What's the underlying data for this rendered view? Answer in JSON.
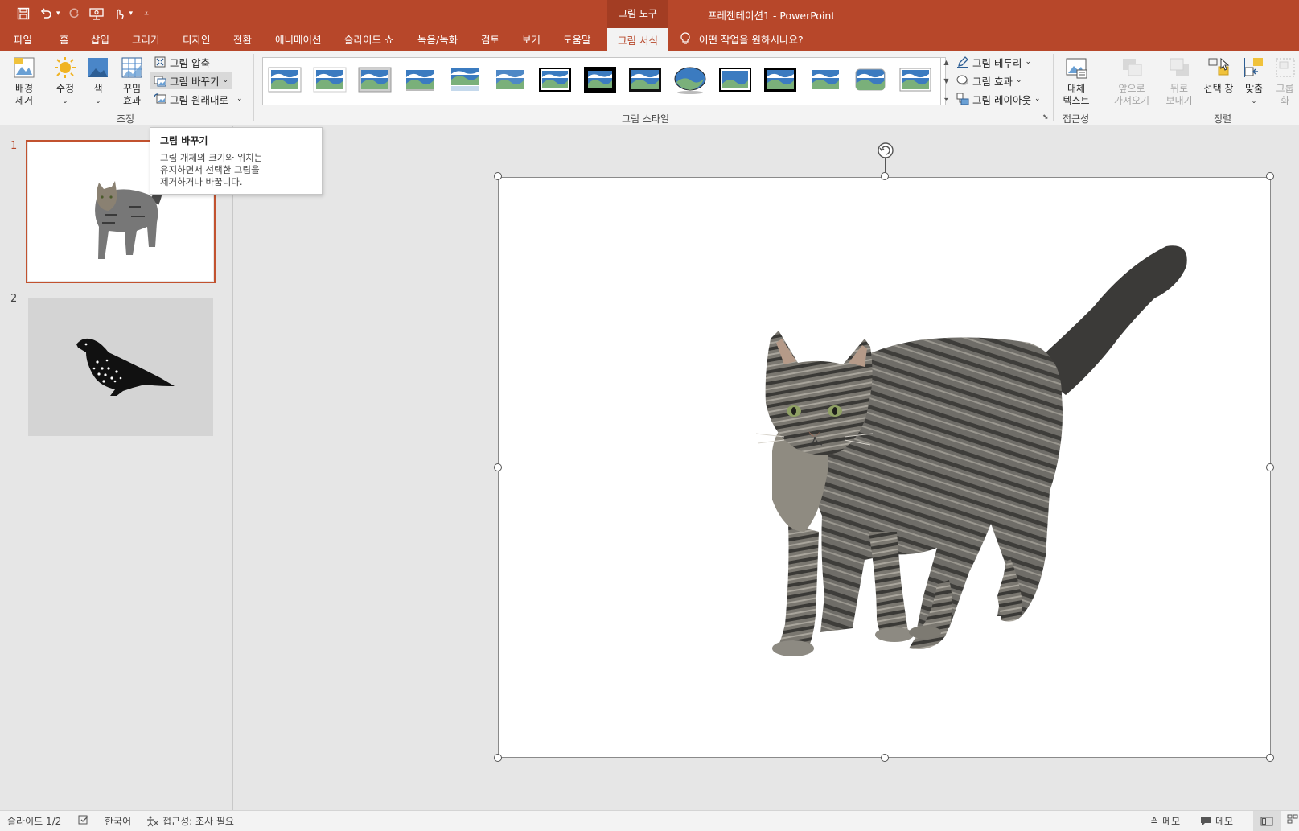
{
  "window": {
    "context_tab_title": "그림 도구",
    "doc_title": "프레젠테이션1  -  PowerPoint"
  },
  "tabs": [
    {
      "label": "파일"
    },
    {
      "label": "홈"
    },
    {
      "label": "삽입"
    },
    {
      "label": "그리기"
    },
    {
      "label": "디자인"
    },
    {
      "label": "전환"
    },
    {
      "label": "애니메이션"
    },
    {
      "label": "슬라이드 쇼"
    },
    {
      "label": "녹음/녹화"
    },
    {
      "label": "검토"
    },
    {
      "label": "보기"
    },
    {
      "label": "도움말"
    },
    {
      "label": "그림 서식"
    }
  ],
  "tell_me": "어떤 작업을 원하시나요?",
  "ribbon": {
    "remove_bg": [
      "배경",
      "제거"
    ],
    "corrections": "수정",
    "color": "색",
    "artistic": [
      "꾸밈",
      "효과"
    ],
    "compress": "그림 압축",
    "change": "그림 바꾸기",
    "reset": "그림 원래대로",
    "group_adjust": "조정",
    "group_styles": "그림 스타일",
    "border": "그림 테두리",
    "effects": "그림 효과",
    "layout": "그림 레이아웃",
    "alt_text": [
      "대체",
      "텍스트"
    ],
    "group_access": "접근성",
    "bring_forward": [
      "앞으로",
      "가져오기"
    ],
    "send_backward": [
      "뒤로",
      "보내기"
    ],
    "selection_pane": "선택 창",
    "align": "맞춤",
    "group": [
      "그룹",
      "화"
    ],
    "group_arrange": "정렬"
  },
  "tooltip": {
    "title": "그림 바꾸기",
    "lines": [
      "그림 개체의 크기와 위치는",
      "유지하면서 선택한 그림을",
      "제거하거나 바꿉니다."
    ]
  },
  "slides": [
    {
      "number": "1"
    },
    {
      "number": "2"
    }
  ],
  "status": {
    "slide_info": "슬라이드 1/2",
    "language": "한국어",
    "accessibility": "접근성: 조사 필요",
    "notes": "메모",
    "comments": "메모"
  },
  "colors": {
    "accent": "#b7472a",
    "ribbon_bg": "#f3f3f3",
    "workspace_bg": "#e6e6e6"
  }
}
